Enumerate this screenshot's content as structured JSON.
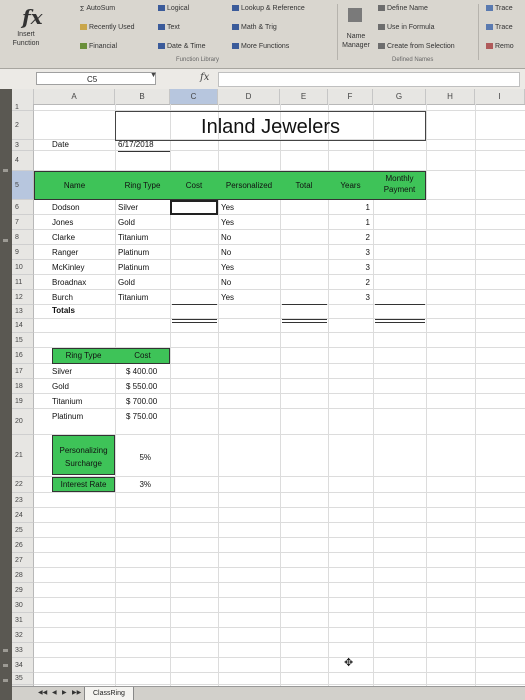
{
  "ribbon": {
    "insert_function": "Insert\nFunction",
    "autosum": "AutoSum",
    "recently_used": "Recently Used",
    "financial": "Financial",
    "logical": "Logical",
    "text": "Text",
    "date_time": "Date & Time",
    "lookup": "Lookup & Reference",
    "math": "Math & Trig",
    "more_functions": "More Functions",
    "function_library": "Function Library",
    "name_manager": "Name\nManager",
    "define_name": "Define Name",
    "use_in_formula": "Use in Formula",
    "create_from_selection": "Create from Selection",
    "defined_names": "Defined Names",
    "trace1": "Trace",
    "trace2": "Trace",
    "remove": "Remo"
  },
  "formula_bar": {
    "name_box": "C5",
    "fx": "fx"
  },
  "columns": [
    "A",
    "B",
    "C",
    "D",
    "E",
    "F",
    "G",
    "H",
    "I"
  ],
  "rows": [
    "1",
    "2",
    "3",
    "4",
    "5",
    "6",
    "7",
    "8",
    "9",
    "10",
    "11",
    "12",
    "13",
    "14",
    "15",
    "16",
    "17",
    "18",
    "19",
    "20",
    "21",
    "22",
    "23",
    "24",
    "25",
    "26",
    "27",
    "28",
    "29",
    "30",
    "31",
    "32",
    "33",
    "34",
    "35",
    "36"
  ],
  "sheet": {
    "title": "Inland Jewelers",
    "date_label": "Date",
    "date_value": "6/17/2018",
    "headers": {
      "name": "Name",
      "ring_type": "Ring Type",
      "cost": "Cost",
      "personalized": "Personalized",
      "total": "Total",
      "years": "Years",
      "monthly_payment": "Monthly Payment"
    },
    "records": [
      {
        "name": "Dodson",
        "ring": "Silver",
        "personalized": "Yes",
        "years": "1"
      },
      {
        "name": "Jones",
        "ring": "Gold",
        "personalized": "Yes",
        "years": "1"
      },
      {
        "name": "Clarke",
        "ring": "Titanium",
        "personalized": "No",
        "years": "2"
      },
      {
        "name": "Ranger",
        "ring": "Platinum",
        "personalized": "No",
        "years": "3"
      },
      {
        "name": "McKinley",
        "ring": "Platinum",
        "personalized": "Yes",
        "years": "3"
      },
      {
        "name": "Broadnax",
        "ring": "Gold",
        "personalized": "No",
        "years": "2"
      },
      {
        "name": "Burch",
        "ring": "Titanium",
        "personalized": "Yes",
        "years": "3"
      }
    ],
    "totals_label": "Totals",
    "lookup": {
      "header_ring": "Ring Type",
      "header_cost": "Cost",
      "items": [
        {
          "ring": "Silver",
          "cost": "$ 400.00"
        },
        {
          "ring": "Gold",
          "cost": "$ 550.00"
        },
        {
          "ring": "Titanium",
          "cost": "$ 700.00"
        },
        {
          "ring": "Platinum",
          "cost": "$ 750.00"
        }
      ]
    },
    "surcharge_label": "Personalizing Surcharge",
    "surcharge_value": "5%",
    "interest_label": "Interest Rate",
    "interest_value": "3%"
  },
  "tabs": {
    "active": "ClassRing"
  },
  "colors": {
    "green_fill": "#3ec358",
    "selection": "#b7c6de"
  }
}
